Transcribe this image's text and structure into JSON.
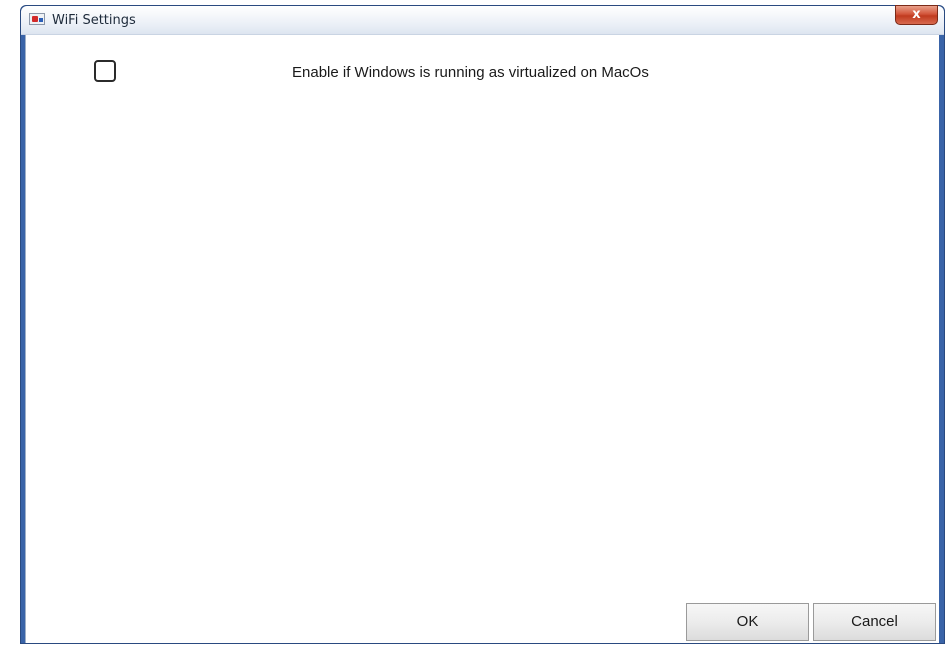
{
  "window": {
    "title": "WiFi Settings",
    "close_label": "x"
  },
  "options": {
    "virtualized_macos": {
      "label": "Enable if Windows is running as virtualized on MacOs",
      "checked": false
    }
  },
  "buttons": {
    "ok_label": "OK",
    "cancel_label": "Cancel"
  },
  "icons": {
    "app": "app-icon",
    "close": "close-icon"
  },
  "colors": {
    "close_button": "#c93d21",
    "titlebar": "#e9eef6",
    "frame": "#3a64a8"
  }
}
